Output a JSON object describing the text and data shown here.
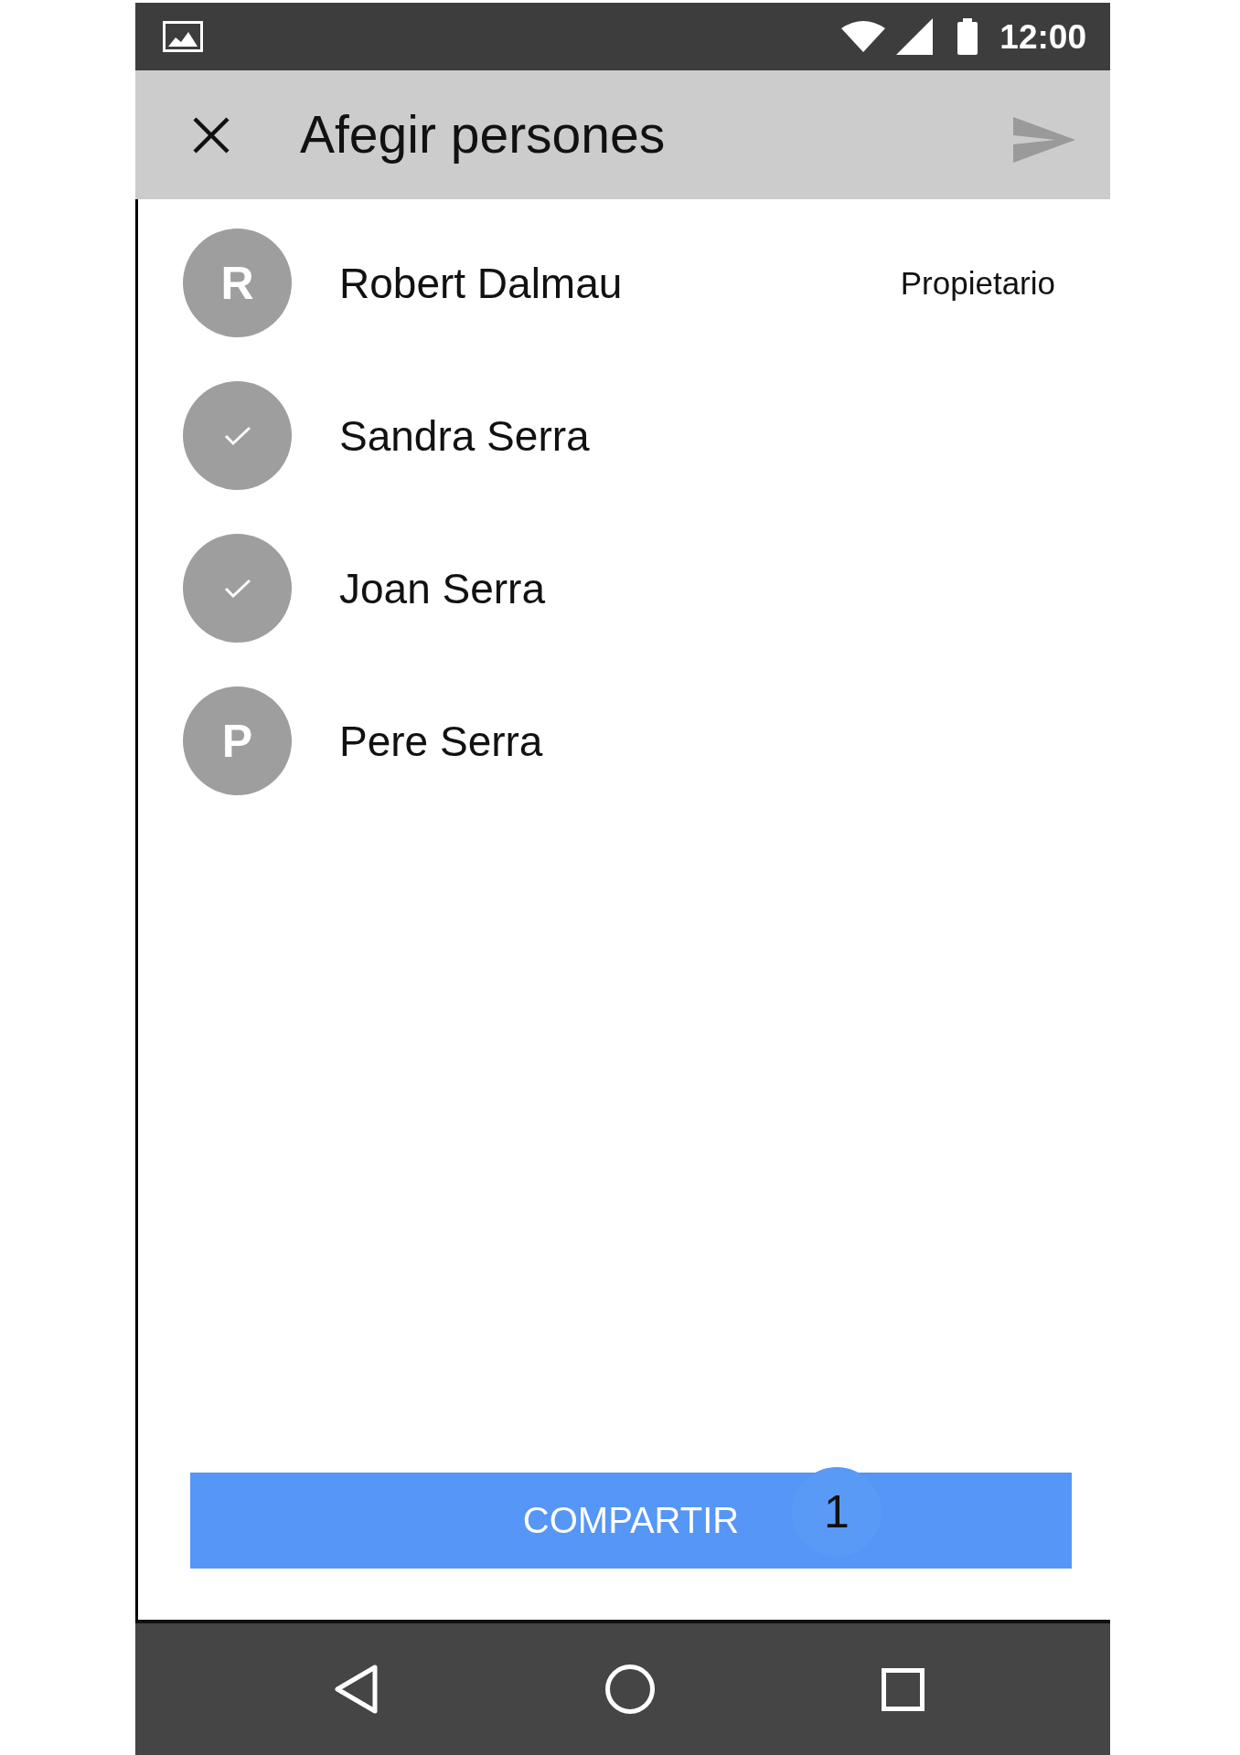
{
  "status_bar": {
    "time": "12:00"
  },
  "app_bar": {
    "title": "Afegir persones",
    "send_button": {
      "disabled": true
    }
  },
  "contacts": [
    {
      "initial": "R",
      "name": "Robert Dalmau",
      "role": "Propietario",
      "selected": false
    },
    {
      "name": "Sandra Serra",
      "selected": true
    },
    {
      "name": "Joan Serra",
      "selected": true
    },
    {
      "initial": "P",
      "name": "Pere Serra",
      "selected": false
    }
  ],
  "share_button": {
    "label": "COMPARTIR",
    "count": "1"
  }
}
